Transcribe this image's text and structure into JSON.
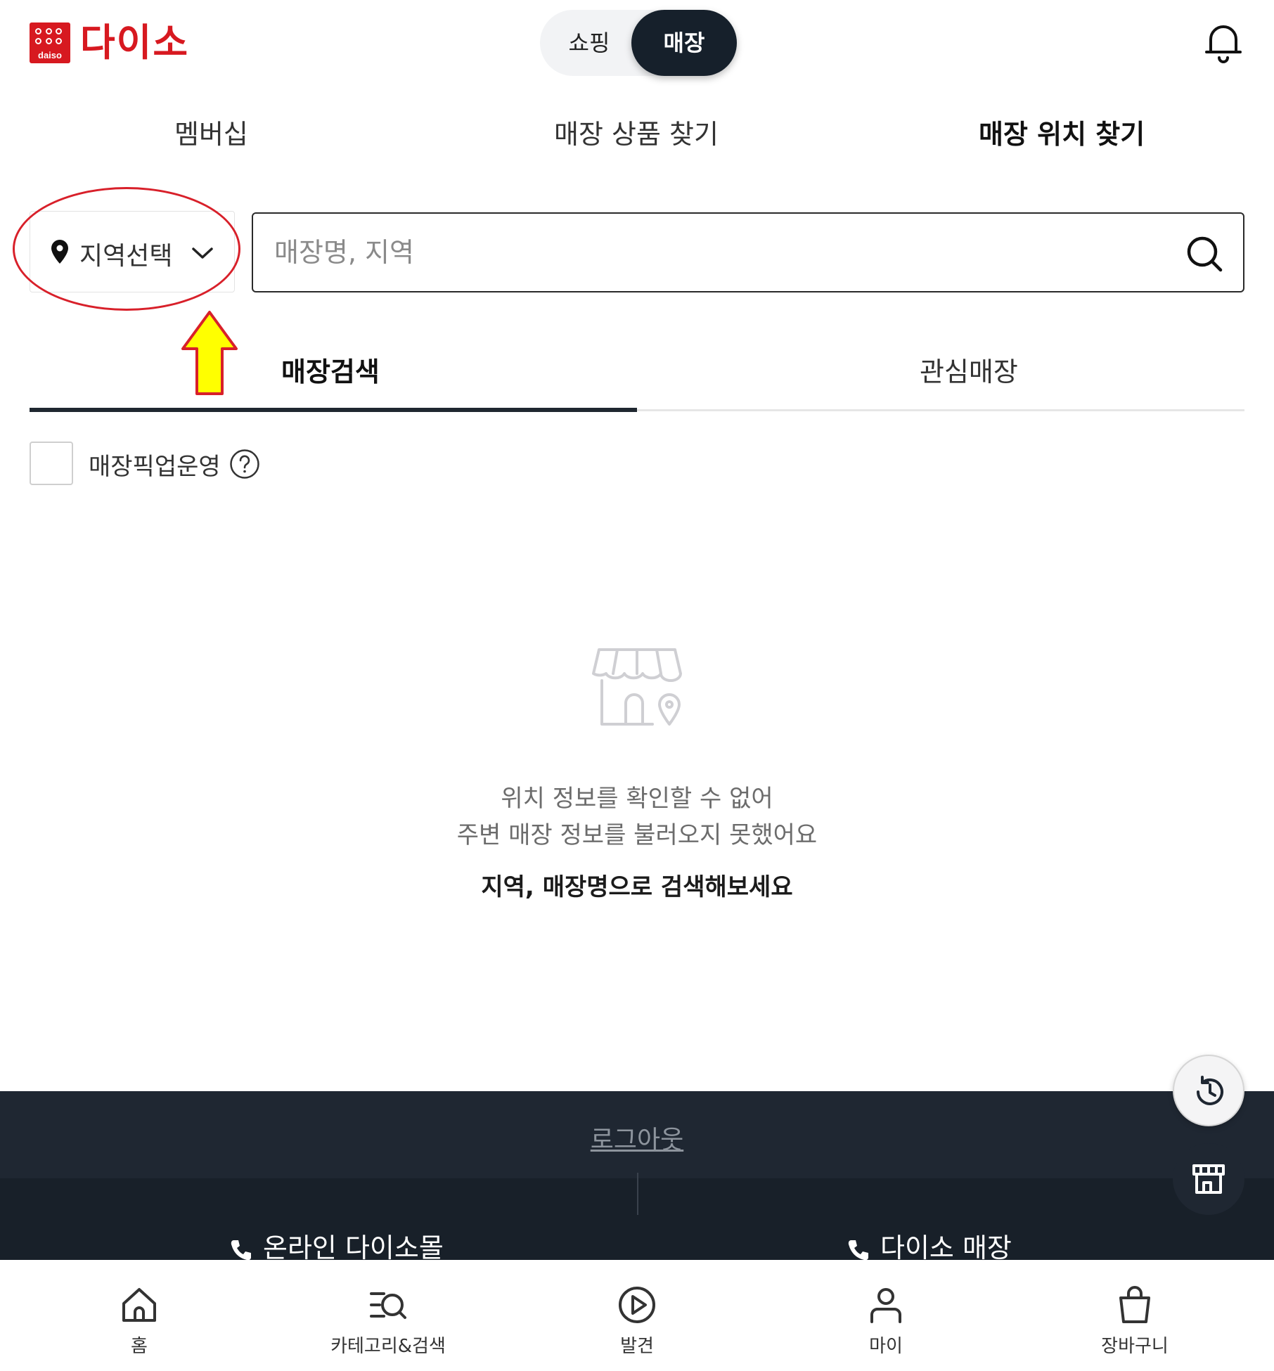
{
  "header": {
    "logo_sub": "daiso",
    "logo_text": "다이소",
    "toggle": {
      "shopping": "쇼핑",
      "store": "매장"
    },
    "bell_icon": "bell-icon"
  },
  "top_tabs": [
    {
      "label": "멤버십"
    },
    {
      "label": "매장 상품 찾기"
    },
    {
      "label": "매장 위치 찾기",
      "active": true
    }
  ],
  "region": {
    "label": "지역선택",
    "icon": "location-pin-icon"
  },
  "search": {
    "value": "",
    "placeholder": "매장명, 지역",
    "icon": "search-icon"
  },
  "sub_tabs": [
    {
      "label": "매장검색",
      "active": true
    },
    {
      "label": "관심매장"
    }
  ],
  "pickup": {
    "label": "매장픽업운영",
    "checked": false
  },
  "empty_state": {
    "line1": "위치 정보를 확인할 수 없어",
    "line2": "주변 매장 정보를 불러오지 못했어요",
    "line3": "지역, 매장명으로 검색해보세요"
  },
  "footer": {
    "logout": "로그아웃",
    "contact_online": "온라인 다이소몰",
    "contact_store": "다이소 매장"
  },
  "bottom_nav": [
    {
      "label": "홈",
      "icon": "home-icon"
    },
    {
      "label": "카테고리&검색",
      "icon": "category-search-icon"
    },
    {
      "label": "발견",
      "icon": "play-discover-icon"
    },
    {
      "label": "마이",
      "icon": "person-icon"
    },
    {
      "label": "장바구니",
      "icon": "shopping-bag-icon"
    }
  ],
  "colors": {
    "brand_red": "#d71920",
    "dark_navy": "#1f2732",
    "annotation_red": "#d8202a",
    "annotation_yellow": "#ffff00"
  }
}
